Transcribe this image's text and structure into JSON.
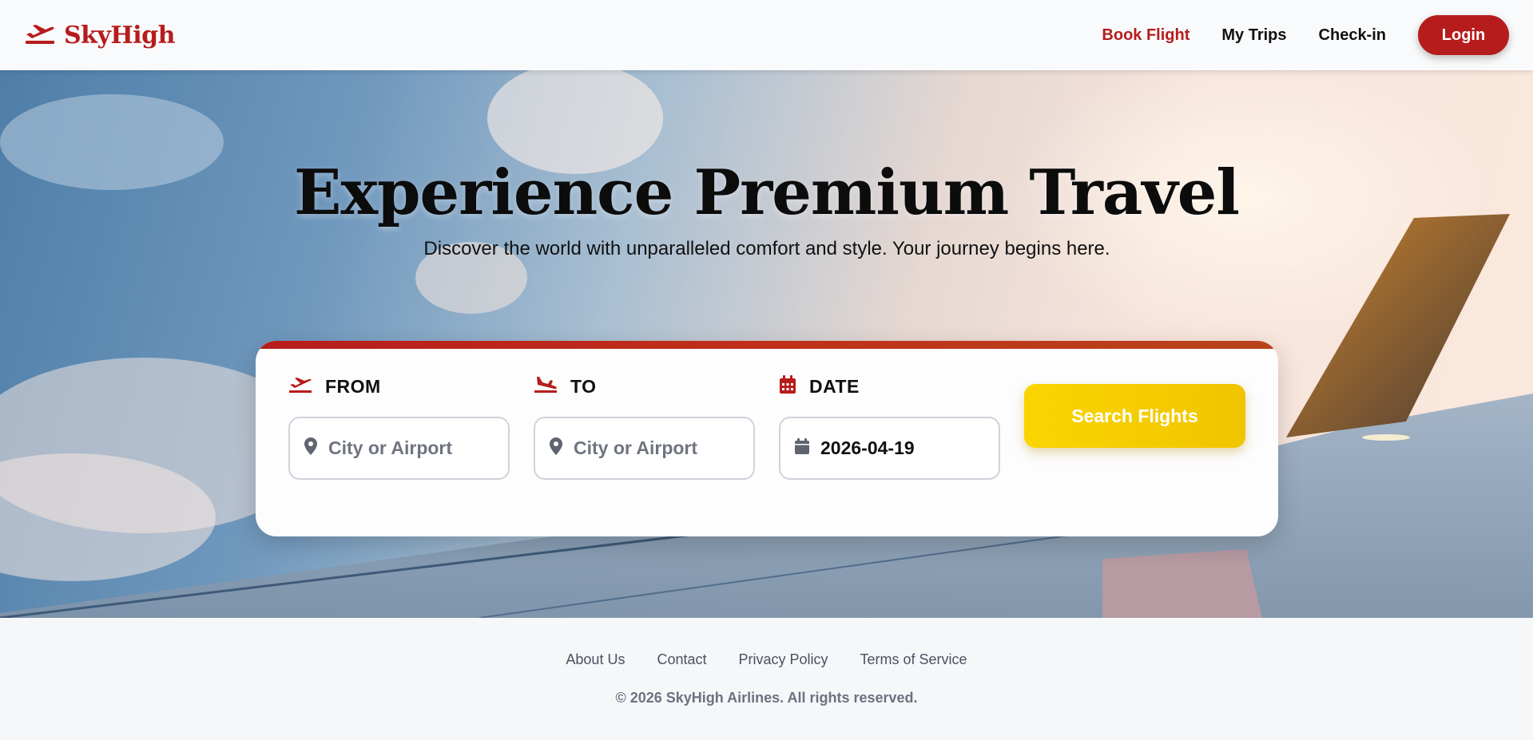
{
  "brand": {
    "name": "SkyHigh",
    "accent_color": "#b71c1c",
    "logo_icon": "plane-departure-icon"
  },
  "nav": {
    "links": [
      {
        "label": "Book Flight",
        "active": true
      },
      {
        "label": "My Trips",
        "active": false
      },
      {
        "label": "Check-in",
        "active": false
      }
    ],
    "login_label": "Login"
  },
  "hero": {
    "title": "Experience Premium Travel",
    "subtitle": "Discover the world with unparalleled comfort and style. Your journey begins here."
  },
  "search": {
    "from": {
      "label": "FROM",
      "icon": "plane-departure-icon",
      "field_icon": "map-pin-icon",
      "placeholder": "City or Airport",
      "value": ""
    },
    "to": {
      "label": "TO",
      "icon": "plane-arrival-icon",
      "field_icon": "map-pin-icon",
      "placeholder": "City or Airport",
      "value": ""
    },
    "date": {
      "label": "DATE",
      "icon": "calendar-icon",
      "field_icon": "calendar-icon",
      "value": "2026-04-19"
    },
    "button_label": "Search Flights",
    "button_color": "#fad502"
  },
  "footer": {
    "links": [
      "About Us",
      "Contact",
      "Privacy Policy",
      "Terms of Service"
    ],
    "copyright": "© 2026 SkyHigh Airlines. All rights reserved."
  }
}
